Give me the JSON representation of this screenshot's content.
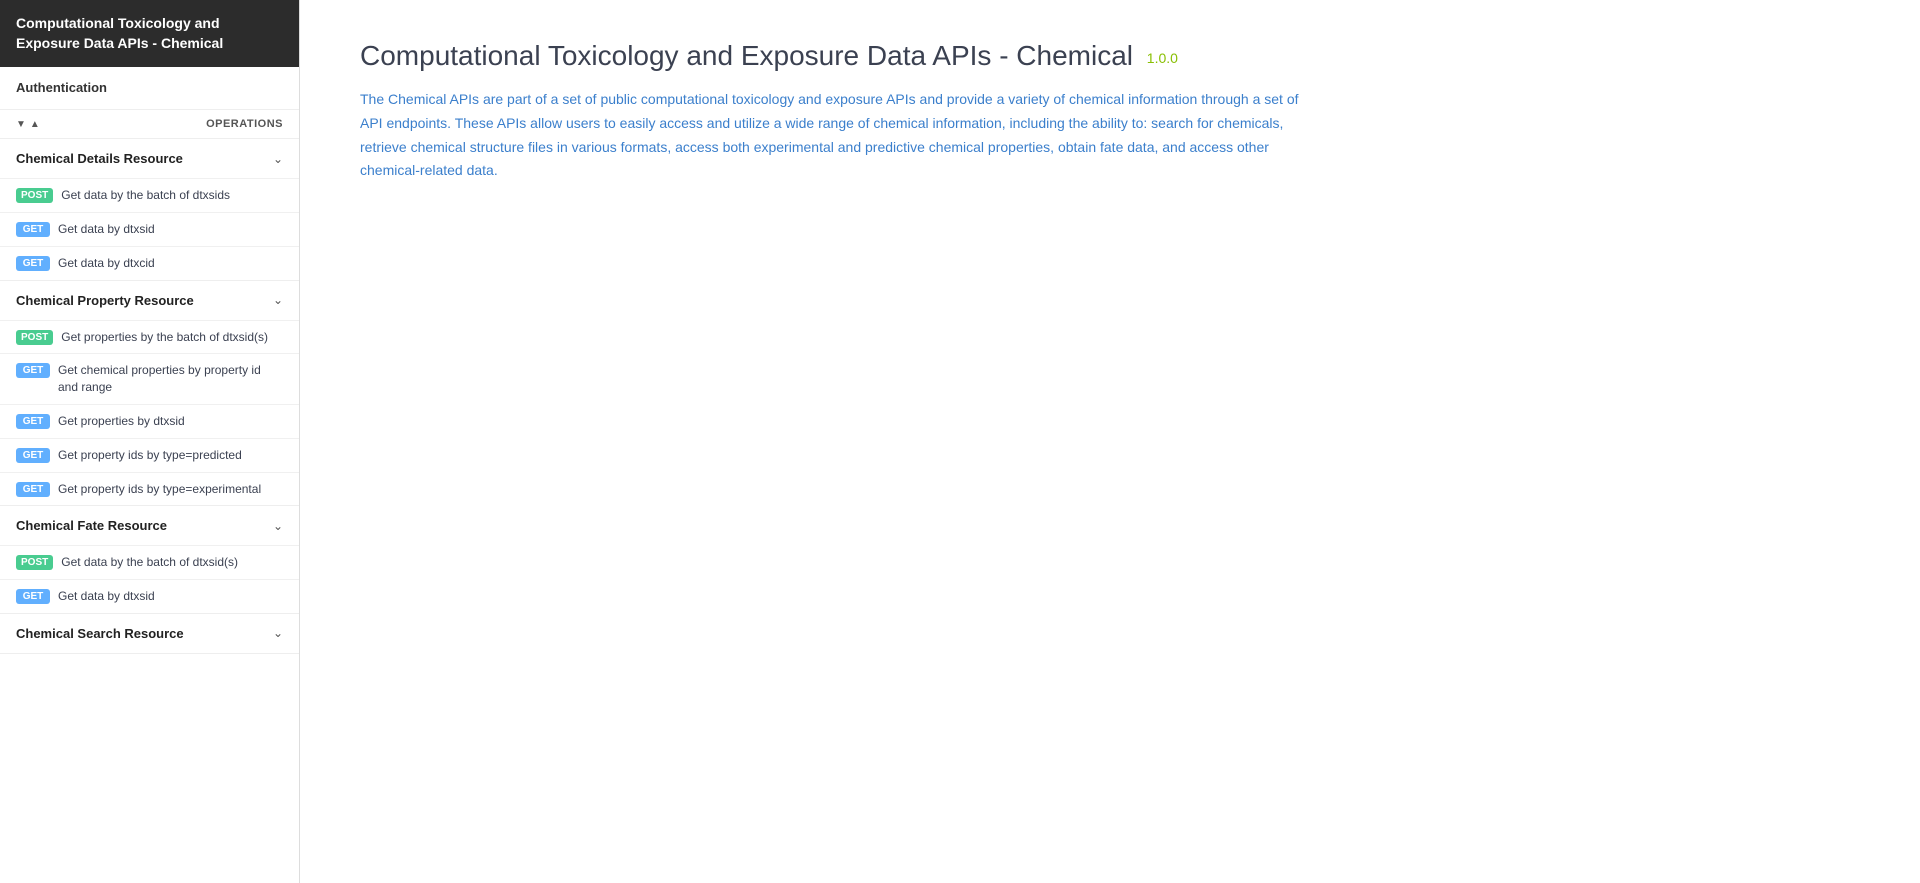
{
  "sidebar": {
    "header": "Computational Toxicology and Exposure Data APIs - Chemical",
    "auth_label": "Authentication",
    "ops_label": "OPERATIONS",
    "expand_up": "▲",
    "expand_down": "▼",
    "sections": [
      {
        "id": "chemical-details",
        "title": "Chemical Details Resource",
        "items": [
          {
            "method": "POST",
            "label": "Get data by the batch of dtxsids"
          },
          {
            "method": "GET",
            "label": "Get data by dtxsid"
          },
          {
            "method": "GET",
            "label": "Get data by dtxcid"
          }
        ]
      },
      {
        "id": "chemical-property",
        "title": "Chemical Property Resource",
        "items": [
          {
            "method": "POST",
            "label": "Get properties by the batch of dtxsid(s)"
          },
          {
            "method": "GET",
            "label": "Get chemical properties by property id and range"
          },
          {
            "method": "GET",
            "label": "Get properties by dtxsid"
          },
          {
            "method": "GET",
            "label": "Get property ids by type=predicted"
          },
          {
            "method": "GET",
            "label": "Get property ids by type=experimental"
          }
        ]
      },
      {
        "id": "chemical-fate",
        "title": "Chemical Fate Resource",
        "items": [
          {
            "method": "POST",
            "label": "Get data by the batch of dtxsid(s)"
          },
          {
            "method": "GET",
            "label": "Get data by dtxsid"
          }
        ]
      },
      {
        "id": "chemical-search",
        "title": "Chemical Search Resource",
        "items": []
      }
    ]
  },
  "main": {
    "title": "Computational Toxicology and Exposure Data APIs - Chemical",
    "version": "1.0.0",
    "description": "The Chemical APIs are part of a set of public computational toxicology and exposure APIs and provide a variety of chemical information through a set of API endpoints. These APIs allow users to easily access and utilize a wide range of chemical information, including the ability to: search for chemicals, retrieve chemical structure files in various formats, access both experimental and predictive chemical properties, obtain fate data, and access other chemical-related data."
  }
}
